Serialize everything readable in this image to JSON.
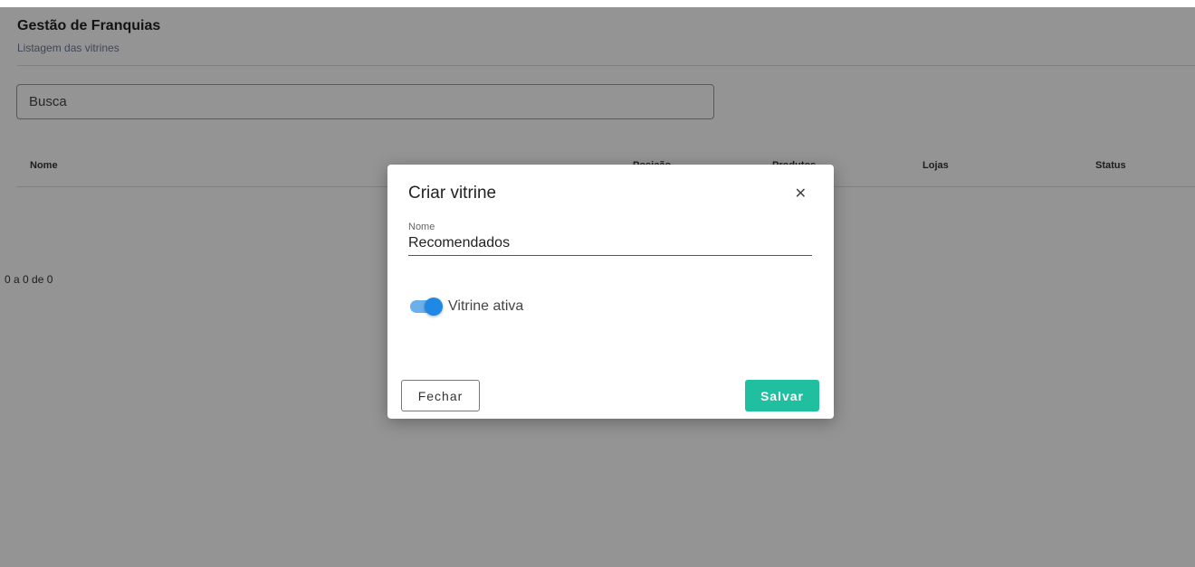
{
  "header": {
    "title": "Gestão de Franquias",
    "subtitle": "Listagem das vitrines"
  },
  "search": {
    "placeholder": "Busca"
  },
  "table": {
    "columns": [
      "Nome",
      "Posição",
      "Produtos",
      "Lojas",
      "Status"
    ]
  },
  "pagination": {
    "label": "0 a 0 de 0"
  },
  "modal": {
    "title": "Criar vitrine",
    "close_icon": "close-icon",
    "name_field": {
      "label": "Nome",
      "value": "Recomendados"
    },
    "toggle": {
      "label": "Vitrine ativa",
      "checked": true
    },
    "buttons": {
      "close_label": "Fechar",
      "save_label": "Salvar"
    }
  },
  "colors": {
    "save_button": "#20bfa0",
    "toggle_knob": "#1e88e5",
    "toggle_track": "#6ab0ec",
    "overlay": "rgba(0,0,0,0.42)"
  }
}
